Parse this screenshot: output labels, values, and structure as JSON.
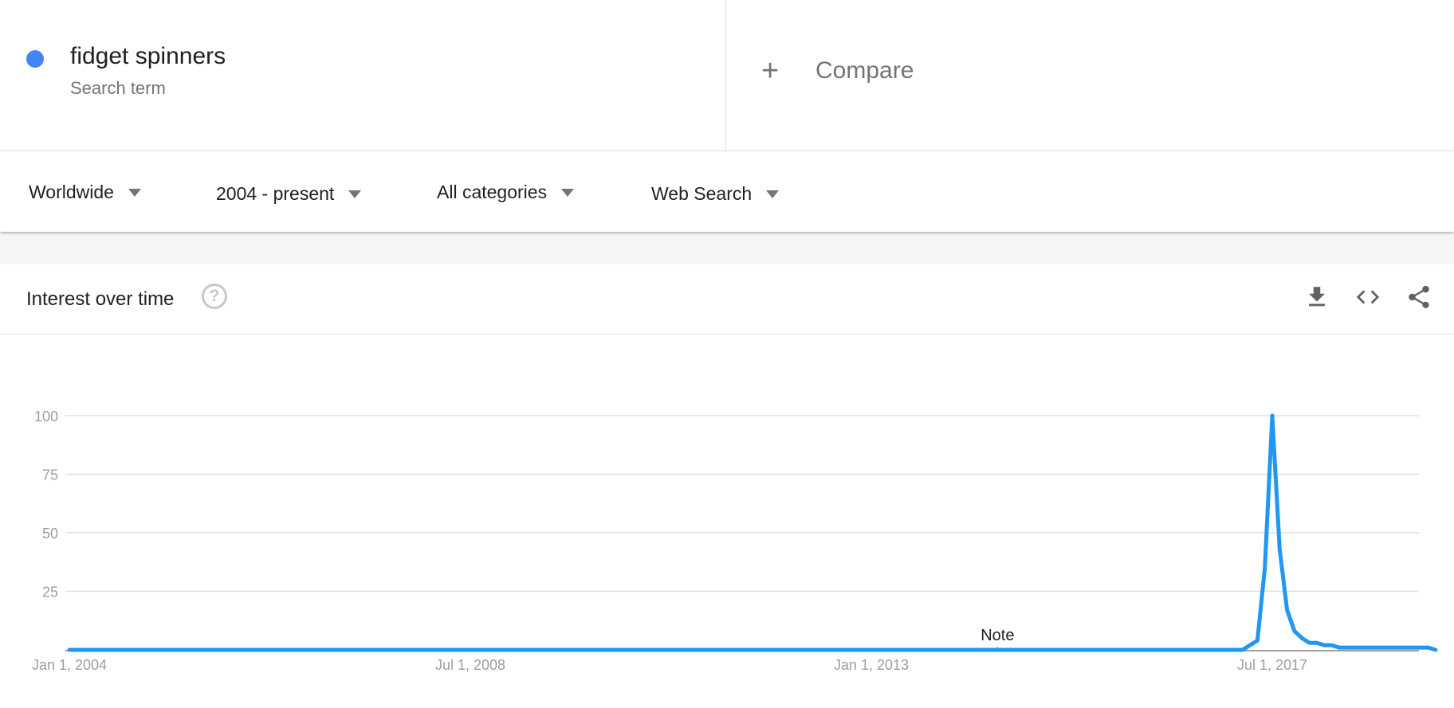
{
  "term": {
    "name": "fidget spinners",
    "type_label": "Search term",
    "color": "#4285f4"
  },
  "compare": {
    "plus": "+",
    "label": "Compare"
  },
  "filters": [
    {
      "label": "Worldwide"
    },
    {
      "label": "2004 - present"
    },
    {
      "label": "All categories"
    },
    {
      "label": "Web Search"
    }
  ],
  "card": {
    "title": "Interest over time",
    "help_symbol": "?",
    "actions": [
      "download-icon",
      "embed-icon",
      "share-icon"
    ]
  },
  "chart_data": {
    "type": "line",
    "title": "Interest over time",
    "xlabel": "",
    "ylabel": "",
    "ylim": [
      0,
      100
    ],
    "yticks": [
      25,
      50,
      75,
      100
    ],
    "xticks": [
      "Jan 1, 2004",
      "Jul 1, 2008",
      "Jan 1, 2013",
      "Jul 1, 2017"
    ],
    "xrange_months": [
      0,
      172
    ],
    "grid": true,
    "line_color": "#2196f3",
    "annotation": {
      "label": "Note",
      "month_index": 125
    },
    "series": [
      {
        "name": "fidget spinners",
        "points": [
          [
            0,
            0
          ],
          [
            158,
            0
          ],
          [
            160,
            4
          ],
          [
            161,
            35
          ],
          [
            162,
            100
          ],
          [
            163,
            43
          ],
          [
            164,
            17
          ],
          [
            165,
            8
          ],
          [
            166,
            5
          ],
          [
            167,
            3
          ],
          [
            168,
            3
          ],
          [
            169,
            2
          ],
          [
            170,
            2
          ],
          [
            171,
            1
          ],
          [
            172,
            1
          ],
          [
            183,
            1
          ],
          [
            184,
            0
          ]
        ]
      }
    ]
  }
}
